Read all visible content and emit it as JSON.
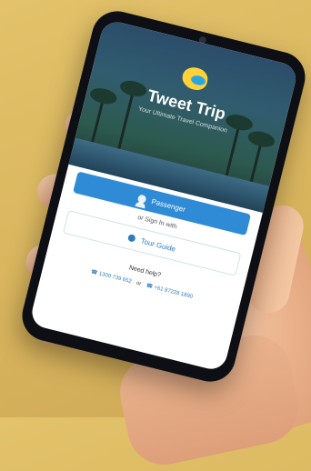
{
  "app": {
    "title": "Tweet Trip",
    "tagline": "Your Ultimate Travel Companion"
  },
  "actions": {
    "primary_label": "Passenger",
    "or_text": "or Sign In with",
    "secondary_label": "Tour Guide"
  },
  "help": {
    "title": "Need help?",
    "phone_1": "☎ 1300 739 652",
    "or": "or",
    "phone_2": "☎ +61 87228 1890"
  },
  "colors": {
    "background": "#d9b55e",
    "primary_button": "#2f8bd6",
    "secondary_text": "#2f7cc1",
    "logo_yellow": "#ffd23a",
    "logo_blue": "#2aa6df"
  }
}
